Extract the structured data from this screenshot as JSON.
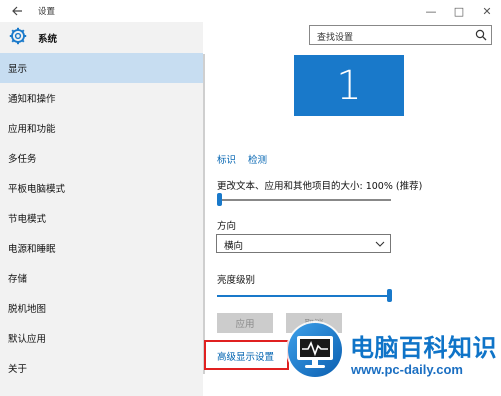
{
  "window": {
    "title": "设置",
    "controls": {
      "minimize": "—",
      "maximize": "□",
      "close": "✕"
    }
  },
  "sidebar": {
    "brand_label": "系统",
    "items": [
      {
        "label": "显示",
        "active": true
      },
      {
        "label": "通知和操作"
      },
      {
        "label": "应用和功能"
      },
      {
        "label": "多任务"
      },
      {
        "label": "平板电脑模式"
      },
      {
        "label": "节电模式"
      },
      {
        "label": "电源和睡眠"
      },
      {
        "label": "存储"
      },
      {
        "label": "脱机地图"
      },
      {
        "label": "默认应用"
      },
      {
        "label": "关于"
      }
    ]
  },
  "search": {
    "text": "查找设置"
  },
  "display": {
    "monitor_number": "1",
    "identify_link": "标识",
    "detect_link": "检测",
    "scale_label": "更改文本、应用和其他项目的大小: 100% (推荐)",
    "scale_slider_value": 0.0,
    "orientation_label": "方向",
    "orientation_value": "横向",
    "brightness_label": "亮度级别",
    "brightness_slider_value": 1.0,
    "apply_button": "应用",
    "cancel_button": "取消",
    "advanced_link": "高级显示设置"
  },
  "watermark": {
    "cn": "电脑百科知识",
    "url": "www.pc-daily.com"
  },
  "colors": {
    "accent": "#1979ca",
    "link": "#0063b1",
    "sidebar_bg": "#f2f2f2",
    "active_item": "#c7ddf1",
    "highlight": "#e02020"
  }
}
